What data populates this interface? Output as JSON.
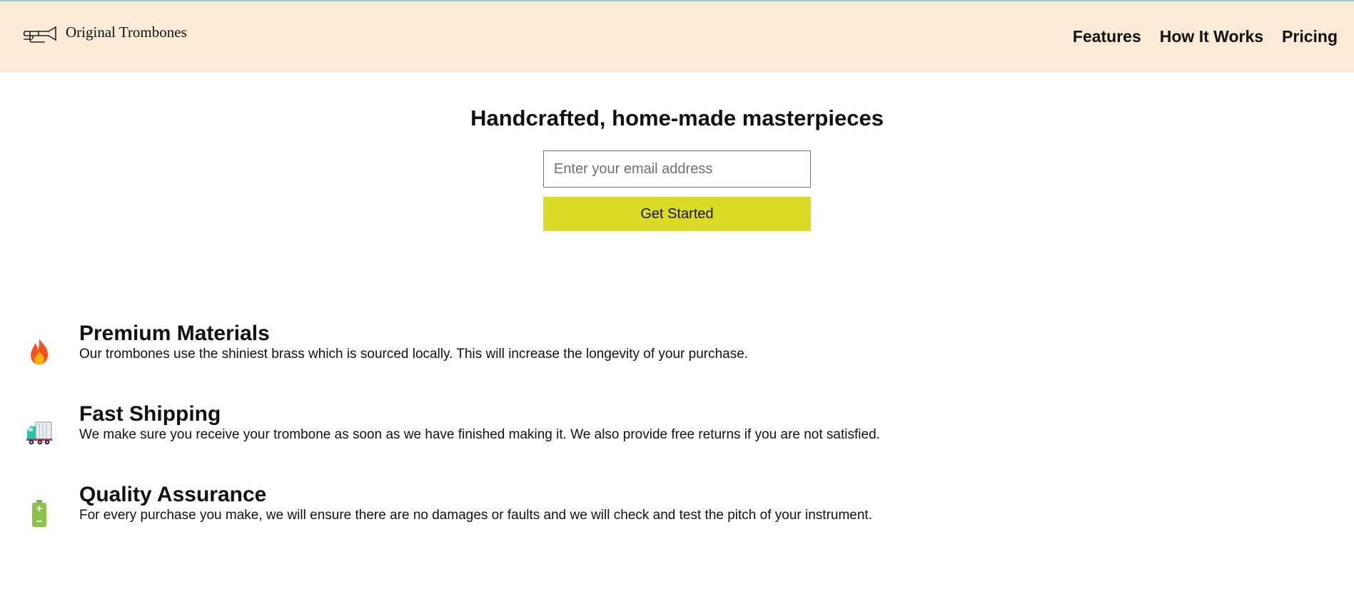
{
  "header": {
    "brand": "Original Trombones",
    "brand_icon": "trombone-icon",
    "nav": [
      {
        "label": "Features"
      },
      {
        "label": "How It Works"
      },
      {
        "label": "Pricing"
      }
    ]
  },
  "hero": {
    "title": "Handcrafted, home-made masterpieces",
    "email_placeholder": "Enter your email address",
    "cta_label": "Get Started"
  },
  "features": [
    {
      "icon": "fire-icon",
      "title": "Premium Materials",
      "description": "Our trombones use the shiniest brass which is sourced locally. This will increase the longevity of your purchase."
    },
    {
      "icon": "truck-icon",
      "title": "Fast Shipping",
      "description": "We make sure you receive your trombone as soon as we have finished making it. We also provide free returns if you are not satisfied."
    },
    {
      "icon": "battery-icon",
      "title": "Quality Assurance",
      "description": "For every purchase you make, we will ensure there are no damages or faults and we will check and test the pitch of your instrument."
    }
  ],
  "colors": {
    "header_bg": "#fbebd6",
    "cta_bg": "#dbdb26",
    "top_line": "#8ecbc8"
  }
}
